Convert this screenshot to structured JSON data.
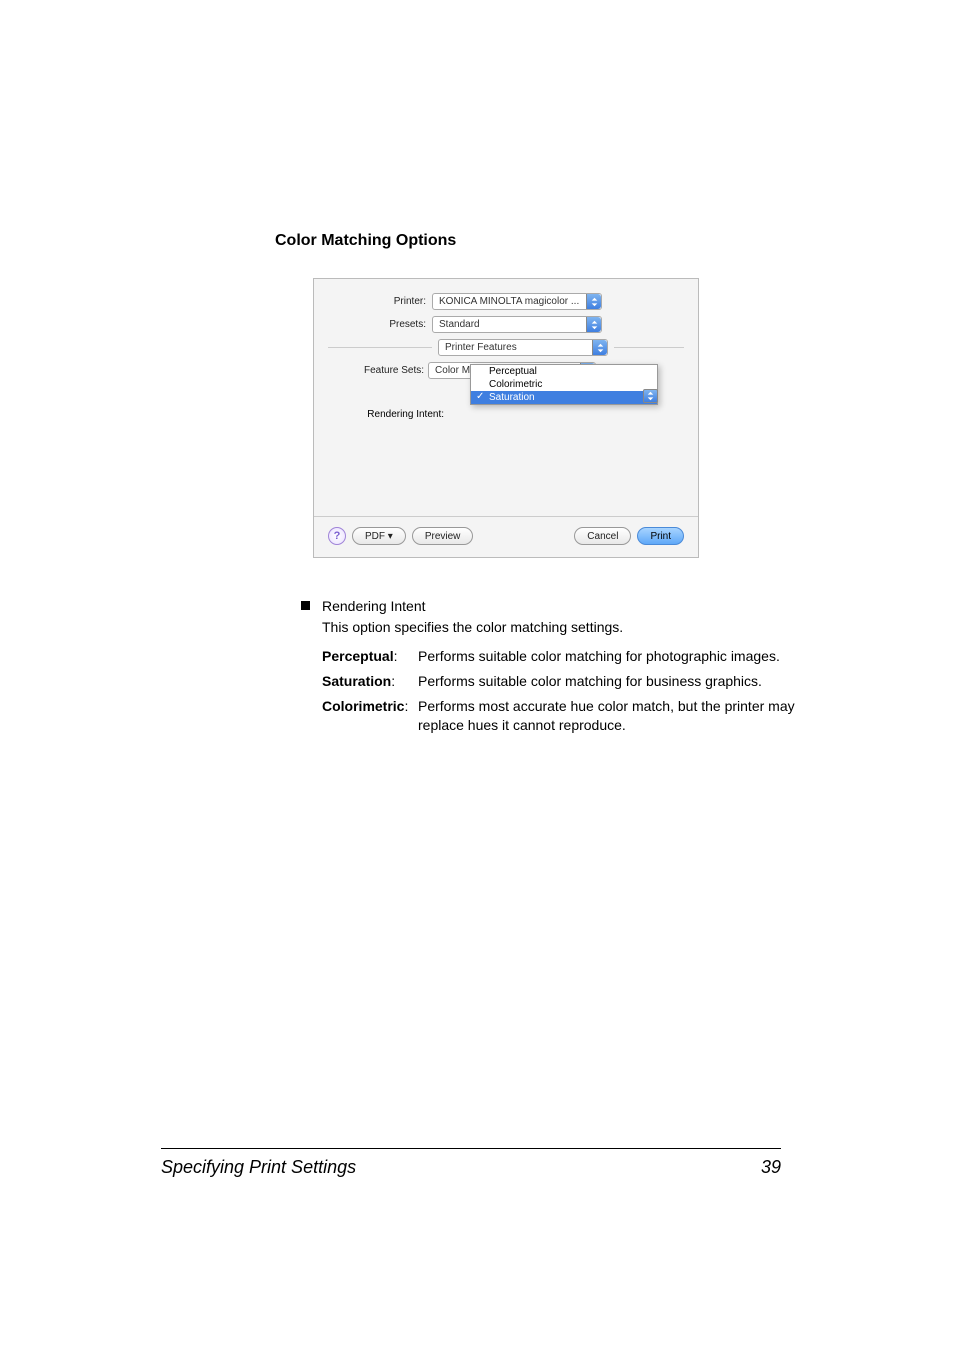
{
  "section": {
    "title": "Color Matching Options"
  },
  "dialog": {
    "printer": {
      "label": "Printer:",
      "value": "KONICA MINOLTA magicolor ..."
    },
    "presets": {
      "label": "Presets:",
      "value": "Standard"
    },
    "panel": {
      "value": "Printer Features"
    },
    "feature_sets": {
      "label": "Feature Sets:",
      "value": "Color Matching Options"
    },
    "rendering_intent": {
      "label": "Rendering Intent:",
      "options": [
        "Perceptual",
        "Colorimetric",
        "Saturation"
      ],
      "selected": "Saturation"
    },
    "buttons": {
      "help": "?",
      "pdf": "PDF ▾",
      "preview": "Preview",
      "cancel": "Cancel",
      "print": "Print"
    }
  },
  "body": {
    "bullet": "Rendering Intent",
    "intro": "This option specifies the color matching settings.",
    "defs": [
      {
        "term": "Perceptual",
        "desc": "Performs suitable color matching for photographic images."
      },
      {
        "term": "Saturation",
        "desc": "Performs suitable color matching for business graphics."
      },
      {
        "term": "Colorimetric",
        "desc": "Performs most accurate hue color match, but the printer may replace hues it cannot reproduce."
      }
    ]
  },
  "footer": {
    "section": "Specifying Print Settings",
    "page": "39"
  }
}
